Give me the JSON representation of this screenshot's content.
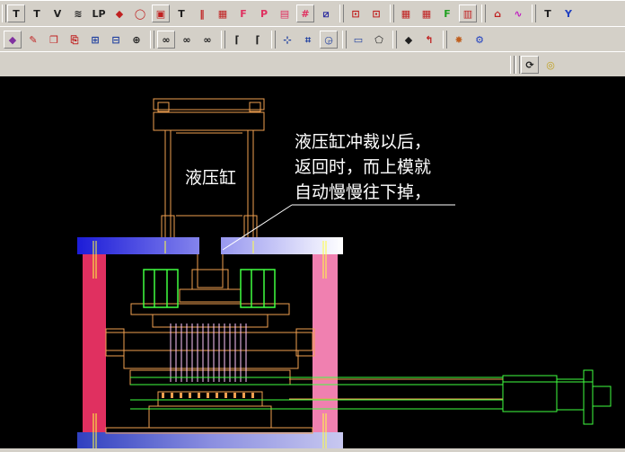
{
  "colors": {
    "canvas_bg": "#000000",
    "toolbar_bg": "#d4d0c8",
    "drawing_orange": "#f0a050",
    "drawing_green": "#40ff40",
    "bar_blue": "#3040e0",
    "bar_pink": "#f080b0",
    "bar_red": "#e03060",
    "annotation_text": "#ffffff"
  },
  "toolbar1": {
    "buttons": [
      {
        "name": "punch-tool-icon",
        "glyph": "T",
        "color": "#202020"
      },
      {
        "name": "punch-tool-2-icon",
        "glyph": "T",
        "color": "#202020"
      },
      {
        "name": "punch-double-icon",
        "glyph": "V",
        "color": "#202020"
      },
      {
        "name": "spring-icon",
        "glyph": "≋",
        "color": "#202020"
      },
      {
        "name": "lp-icon",
        "glyph": "LP",
        "color": "#202020"
      },
      {
        "name": "stack-icon",
        "glyph": "◆",
        "color": "#c02020"
      },
      {
        "name": "cylinder-icon",
        "glyph": "◯",
        "color": "#c02020"
      },
      {
        "name": "plate-icon",
        "glyph": "▣",
        "color": "#c02020"
      },
      {
        "name": "guide-pin-icon",
        "glyph": "T",
        "color": "#202020"
      },
      {
        "name": "bolt-icon",
        "glyph": "‖",
        "color": "#c02020"
      },
      {
        "name": "grid-icon",
        "glyph": "▦",
        "color": "#c02020"
      },
      {
        "name": "frame-icon",
        "glyph": "F",
        "color": "#e03060"
      },
      {
        "name": "bend-icon",
        "glyph": "P",
        "color": "#e03060"
      },
      {
        "name": "block-icon",
        "glyph": "▤",
        "color": "#e03060"
      },
      {
        "name": "mesh-icon",
        "glyph": "#",
        "color": "#e03060"
      },
      {
        "name": "slash-icon",
        "glyph": "⧄",
        "color": "#3030a0"
      },
      {
        "name": "book-icon",
        "glyph": "⊡",
        "color": "#c02020"
      },
      {
        "name": "book-2-icon",
        "glyph": "⊡",
        "color": "#c02020"
      },
      {
        "name": "grid-2-icon",
        "glyph": "▦",
        "color": "#c02020"
      },
      {
        "name": "grid-3-icon",
        "glyph": "▦",
        "color": "#c02020"
      },
      {
        "name": "frame-2-icon",
        "glyph": "F",
        "color": "#20a020"
      },
      {
        "name": "ladder-icon",
        "glyph": "▥",
        "color": "#c02020"
      },
      {
        "name": "connect-icon",
        "glyph": "⌂",
        "color": "#c02020"
      },
      {
        "name": "wave-icon",
        "glyph": "∿",
        "color": "#c020c0"
      },
      {
        "name": "punch-tool-3-icon",
        "glyph": "T",
        "color": "#202020"
      },
      {
        "name": "filter-icon",
        "glyph": "Y",
        "color": "#2040c0"
      }
    ]
  },
  "toolbar2": {
    "buttons": [
      {
        "name": "eraser-icon",
        "glyph": "◆",
        "color": "#8030a0"
      },
      {
        "name": "pen-icon",
        "glyph": "✎",
        "color": "#c02020"
      },
      {
        "name": "copy-icon",
        "glyph": "❐",
        "color": "#c02020"
      },
      {
        "name": "paste-icon",
        "glyph": "⎘",
        "color": "#c02020"
      },
      {
        "name": "layer-icon",
        "glyph": "⊞",
        "color": "#2040a0"
      },
      {
        "name": "table-icon",
        "glyph": "⊟",
        "color": "#2040a0"
      },
      {
        "name": "plus-circle-icon",
        "glyph": "⊕",
        "color": "#202020"
      },
      {
        "name": "link-icon",
        "glyph": "∞",
        "color": "#202020"
      },
      {
        "name": "link-2-icon",
        "glyph": "∞",
        "color": "#202020"
      },
      {
        "name": "link-3-icon",
        "glyph": "∞",
        "color": "#202020"
      },
      {
        "name": "fillet-icon",
        "glyph": "⌈",
        "color": "#202020"
      },
      {
        "name": "chamfer-icon",
        "glyph": "⌈",
        "color": "#202020"
      },
      {
        "name": "dimension-icon",
        "glyph": "⊹",
        "color": "#2040a0"
      },
      {
        "name": "crop-icon",
        "glyph": "⌗",
        "color": "#2040a0"
      },
      {
        "name": "region-icon",
        "glyph": "◶",
        "color": "#2040a0"
      },
      {
        "name": "rectangle-icon",
        "glyph": "▭",
        "color": "#2040a0"
      },
      {
        "name": "pentagon-icon",
        "glyph": "⬠",
        "color": "#202020"
      },
      {
        "name": "point-icon",
        "glyph": "◆",
        "color": "#202020"
      },
      {
        "name": "hook-icon",
        "glyph": "↰",
        "color": "#c02020"
      },
      {
        "name": "spark-icon",
        "glyph": "✸",
        "color": "#c06020"
      },
      {
        "name": "settings-icon",
        "glyph": "⚙",
        "color": "#2040c0"
      }
    ]
  },
  "toolbar3": {
    "buttons": [
      {
        "name": "rotate-view-icon",
        "glyph": "⟳",
        "color": "#202020"
      },
      {
        "name": "color-wheel-icon",
        "glyph": "◎",
        "color": "#c0a020"
      }
    ]
  },
  "drawing": {
    "cylinder_label": "液压缸",
    "annotation_lines": [
      "液压缸冲裁以后，",
      "返回时，而上模就",
      "自动慢慢往下掉，"
    ]
  }
}
